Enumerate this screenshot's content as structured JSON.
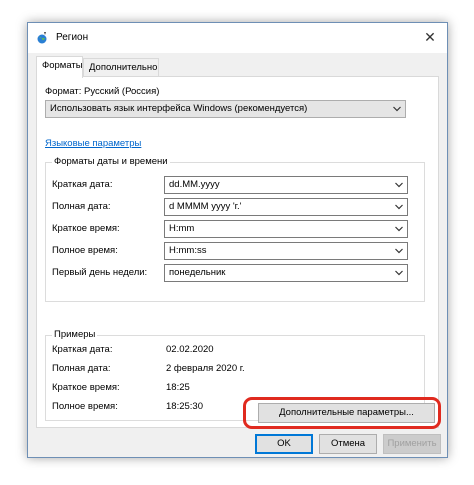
{
  "window": {
    "title": "Регион",
    "close_glyph": "✕"
  },
  "tabs": [
    {
      "label": "Форматы",
      "active": true
    },
    {
      "label": "Дополнительно",
      "active": false
    }
  ],
  "format": {
    "label": "Формат: Русский (Россия)",
    "value": "Использовать язык интерфейса Windows (рекомендуется)",
    "language_link": "Языковые параметры"
  },
  "datetime_group": {
    "title": "Форматы даты и времени",
    "rows": [
      {
        "label": "Краткая дата:",
        "value": "dd.MM.yyyy"
      },
      {
        "label": "Полная дата:",
        "value": "d MMMM yyyy 'г.'"
      },
      {
        "label": "Краткое время:",
        "value": "H:mm"
      },
      {
        "label": "Полное время:",
        "value": "H:mm:ss"
      },
      {
        "label": "Первый день недели:",
        "value": "понедельник"
      }
    ]
  },
  "examples_group": {
    "title": "Примеры",
    "rows": [
      {
        "label": "Краткая дата:",
        "value": "02.02.2020"
      },
      {
        "label": "Полная дата:",
        "value": "2 февраля 2020 г."
      },
      {
        "label": "Краткое время:",
        "value": "18:25"
      },
      {
        "label": "Полное время:",
        "value": "18:25:30"
      }
    ]
  },
  "buttons": {
    "additional": "Дополнительные параметры...",
    "ok": "OK",
    "cancel": "Отмена",
    "apply": "Применить"
  },
  "icons": {
    "app": "region-globe-icon",
    "combo_arrow": "chevron-down-icon",
    "close": "close-icon"
  },
  "colors": {
    "link": "#0066cc",
    "highlight": "#e02a1f",
    "default_button": "#0078d7"
  }
}
